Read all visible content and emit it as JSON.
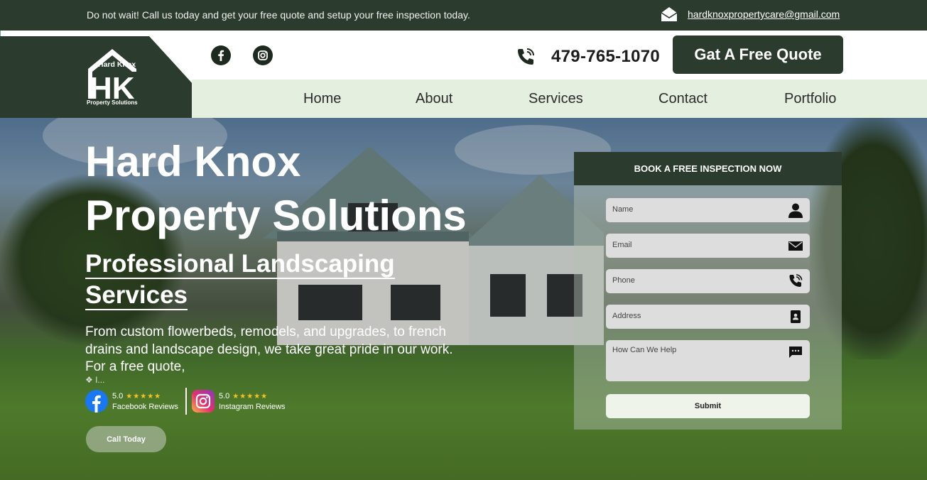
{
  "topbar": {
    "message": "Do not wait! Call us today and get your free quote and setup your free inspection today.",
    "email": "hardknoxpropertycare@gmail.com"
  },
  "brand": {
    "logo_name": "Hard Knox",
    "logo_initials": "HK",
    "logo_tagline": "Property Solutions"
  },
  "header": {
    "phone": "479-765-1070",
    "quote_button": "Gat A Free Quote"
  },
  "nav": {
    "items": [
      "Home",
      "About",
      "Services",
      "Contact",
      "Portfolio"
    ]
  },
  "hero": {
    "title_line1": "Hard Knox",
    "title_line2": "Property Solutions",
    "subtitle_line1": "Professional Landscaping",
    "subtitle_line2": "Services",
    "description": "From custom flowerbeds, remodels, and upgrades, to french drains and landscape design, we take great pride in our work. For a free quote,",
    "more": "❖ I...",
    "call_button": "Call Today"
  },
  "reviews": [
    {
      "platform": "Facebook Reviews",
      "score": "5.0",
      "stars": "★★★★★"
    },
    {
      "platform": "Instagram Reviews",
      "score": "5.0",
      "stars": "★★★★★"
    }
  ],
  "form": {
    "heading": "BOOK A FREE INSPECTION NOW",
    "fields": [
      {
        "label": "Name",
        "icon": "person-icon"
      },
      {
        "label": "Email",
        "icon": "envelope-icon"
      },
      {
        "label": "Phone",
        "icon": "phone-icon"
      },
      {
        "label": "Address",
        "icon": "address-book-icon"
      },
      {
        "label": "How Can We Help",
        "icon": "chat-icon"
      }
    ],
    "submit": "Submit"
  },
  "colors": {
    "brand_dark": "#2b3b2d",
    "nav_bg": "#e4efe0",
    "star": "#f6c21e"
  }
}
